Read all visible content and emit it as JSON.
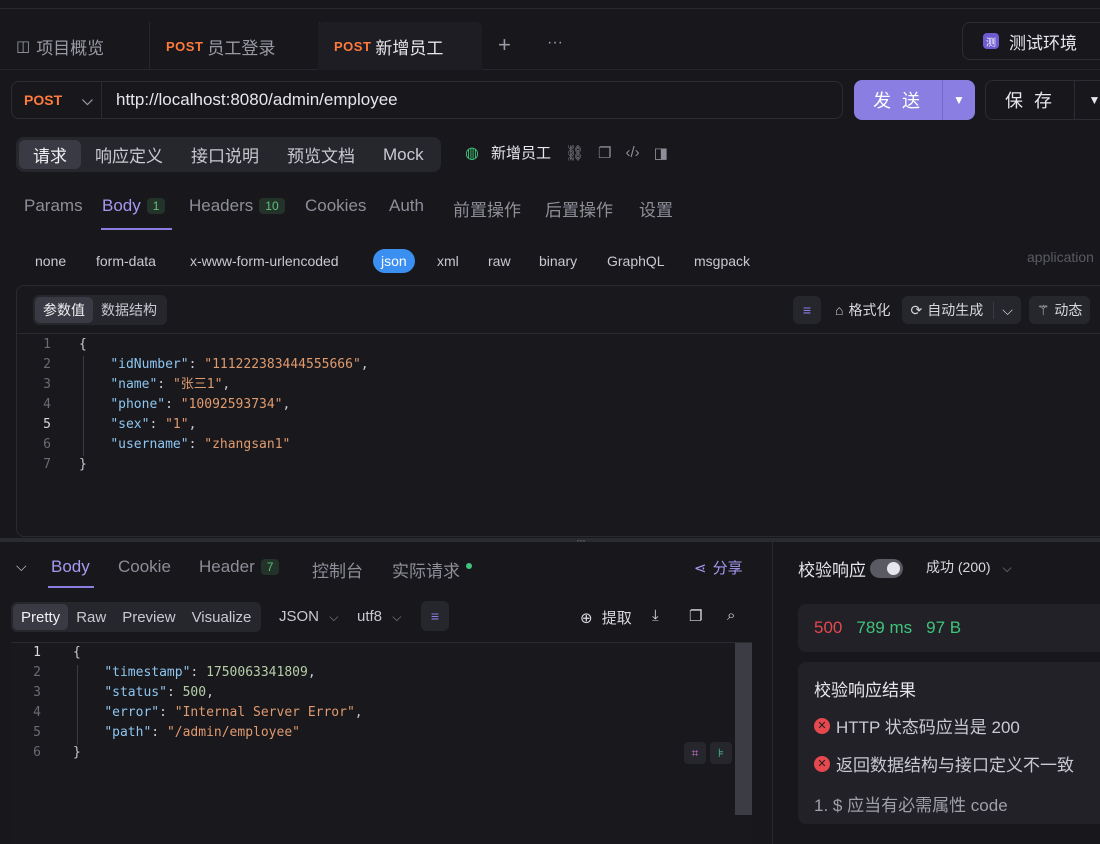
{
  "tabs": {
    "overview": "项目概览",
    "login_method": "POST",
    "login": "员工登录",
    "add_method": "POST",
    "add": "新增员工",
    "plus": "+",
    "more": "···"
  },
  "env": {
    "badge": "测",
    "label": "测试环境"
  },
  "request": {
    "method": "POST",
    "url": "http://localhost:8080/admin/employee",
    "send": "发 送",
    "save": "保 存"
  },
  "segnav": [
    "请求",
    "响应定义",
    "接口说明",
    "预览文档",
    "Mock"
  ],
  "req_name": "新增员工",
  "subtabs": {
    "params": "Params",
    "body": "Body",
    "body_count": "1",
    "headers": "Headers",
    "headers_count": "10",
    "cookies": "Cookies",
    "auth": "Auth",
    "pre": "前置操作",
    "post": "后置操作",
    "settings": "设置"
  },
  "body_types": [
    "none",
    "form-data",
    "x-www-form-urlencoded",
    "json",
    "xml",
    "raw",
    "binary",
    "GraphQL",
    "msgpack"
  ],
  "content_type": "application",
  "editor": {
    "tab_values": "参数值",
    "tab_schema": "数据结构",
    "format": "格式化",
    "autogen": "自动生成",
    "dynamic": "动态",
    "lines": [
      "1",
      "2",
      "3",
      "4",
      "5",
      "6",
      "7"
    ],
    "json": {
      "idNumber_k": "\"idNumber\"",
      "idNumber_v": "\"111222383444555666\"",
      "name_k": "\"name\"",
      "name_v": "\"张三1\"",
      "phone_k": "\"phone\"",
      "phone_v": "\"10092593734\"",
      "sex_k": "\"sex\"",
      "sex_v": "\"1\"",
      "username_k": "\"username\"",
      "username_v": "\"zhangsan1\""
    }
  },
  "response": {
    "tabs": {
      "body": "Body",
      "cookie": "Cookie",
      "header": "Header",
      "header_count": "7",
      "console": "控制台",
      "actual": "实际请求"
    },
    "share": "分享",
    "formats": [
      "Pretty",
      "Raw",
      "Preview",
      "Visualize"
    ],
    "lang": "JSON",
    "encoding": "utf8",
    "extract": "提取",
    "lines": [
      "1",
      "2",
      "3",
      "4",
      "5",
      "6"
    ],
    "json": {
      "timestamp_k": "\"timestamp\"",
      "timestamp_v": "1750063341809",
      "status_k": "\"status\"",
      "status_v": "500",
      "error_k": "\"error\"",
      "error_v": "\"Internal Server Error\"",
      "path_k": "\"path\"",
      "path_v": "\"/admin/employee\""
    }
  },
  "verify": {
    "label": "校验响应",
    "status_select": "成功 (200)",
    "code": "500",
    "time": "789 ms",
    "size": "97 B",
    "results_title": "校验响应结果",
    "result1": "HTTP 状态码应当是 200",
    "result2": "返回数据结构与接口定义不一致",
    "result3": "1. $ 应当有必需属性 code"
  },
  "colors": {
    "accent": "#8b7ee3",
    "post": "#ff7a3d",
    "error": "#e5484d",
    "success": "#3fc47a",
    "json_blue": "#3b8ff0"
  }
}
